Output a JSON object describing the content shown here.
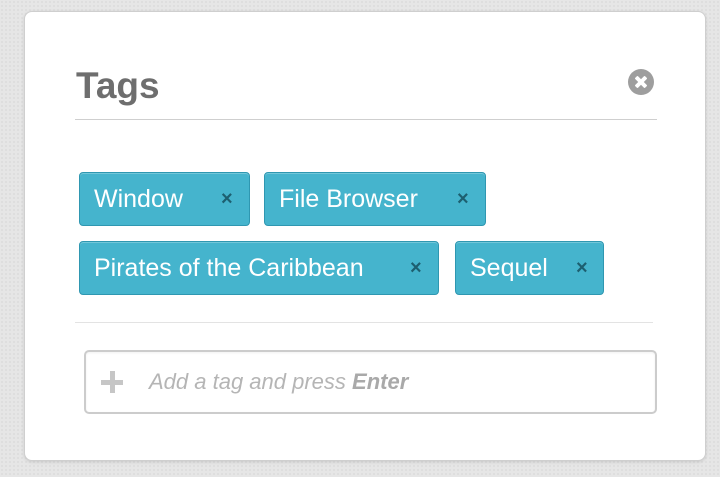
{
  "panel": {
    "title": "Tags",
    "close_icon": "close-circle-icon"
  },
  "tags": [
    {
      "label": "Window",
      "remove": "×"
    },
    {
      "label": "File Browser",
      "remove": "×"
    },
    {
      "label": "Pirates of the Caribbean",
      "remove": "×"
    },
    {
      "label": "Sequel",
      "remove": "×"
    }
  ],
  "add_tag": {
    "icon": "plus-icon",
    "placeholder_prefix": "Add a tag and press",
    "placeholder_key": "Enter"
  },
  "colors": {
    "tag_background": "#45b4cd",
    "tag_border": "#2f97b1",
    "title_text": "#6e6e6e"
  }
}
